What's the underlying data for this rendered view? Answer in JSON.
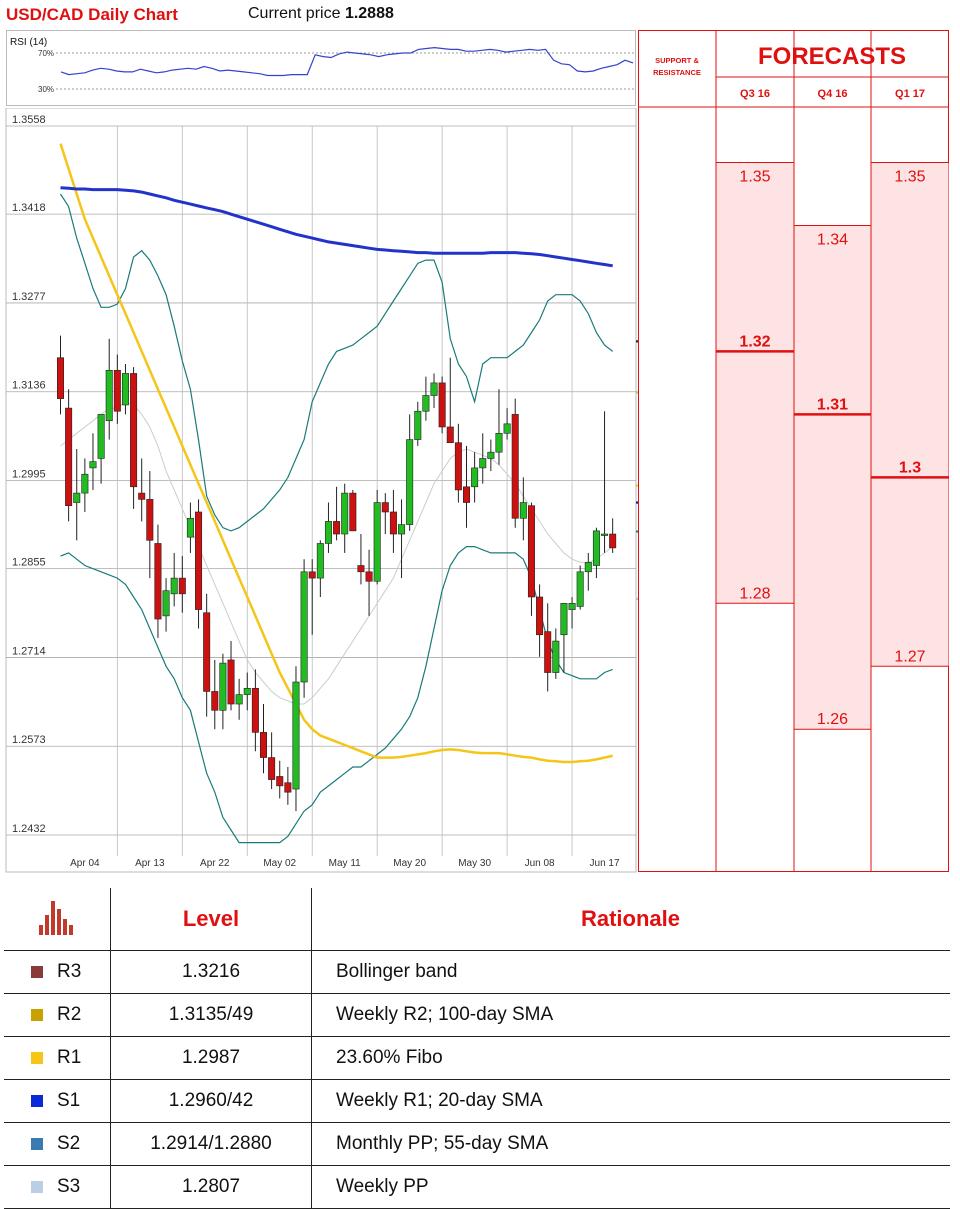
{
  "header": {
    "title": "USD/CAD Daily Chart",
    "price_label": "Current price",
    "price_value": "1.2888"
  },
  "rsi": {
    "label": "RSI (14)",
    "levels": [
      "70%",
      "30%"
    ],
    "values": [
      49,
      46,
      47,
      48,
      51,
      53,
      52,
      50,
      49,
      49,
      52,
      50,
      48,
      49,
      51,
      52,
      53,
      52,
      55,
      53,
      50,
      51,
      50,
      49,
      48,
      47,
      45,
      45,
      45,
      46,
      46,
      46,
      68,
      66,
      65,
      69,
      71,
      70,
      69,
      68,
      66,
      68,
      69,
      70,
      70,
      74,
      75,
      76,
      75,
      74,
      74,
      72,
      72,
      73,
      74,
      73,
      71,
      72,
      73,
      74,
      73,
      74,
      62,
      58,
      57,
      50,
      49,
      50,
      53,
      55,
      57,
      62,
      59
    ]
  },
  "chart_data": {
    "type": "candlestick",
    "title": "USD/CAD Daily Chart",
    "y_ticks": [
      "1.3558",
      "1.3418",
      "1.3277",
      "1.3136",
      "1.2995",
      "1.2855",
      "1.2714",
      "1.2573",
      "1.2432"
    ],
    "ylim": [
      1.2432,
      1.3558
    ],
    "x_ticks": [
      {
        "label": "Apr 04",
        "i": 3
      },
      {
        "label": "Apr 13",
        "i": 11
      },
      {
        "label": "Apr 22",
        "i": 19
      },
      {
        "label": "May 02",
        "i": 27
      },
      {
        "label": "May 11",
        "i": 35
      },
      {
        "label": "May 20",
        "i": 43
      },
      {
        "label": "May 30",
        "i": 51
      },
      {
        "label": "Jun 08",
        "i": 59
      },
      {
        "label": "Jun 17",
        "i": 67
      }
    ],
    "ohlc": [
      [
        1.319,
        1.3225,
        1.31,
        1.3125
      ],
      [
        1.311,
        1.314,
        1.293,
        1.2955
      ],
      [
        1.296,
        1.3045,
        1.29,
        1.2975
      ],
      [
        1.2975,
        1.303,
        1.2945,
        1.3005
      ],
      [
        1.3015,
        1.307,
        1.298,
        1.3025
      ],
      [
        1.303,
        1.309,
        1.299,
        1.31
      ],
      [
        1.309,
        1.322,
        1.306,
        1.317
      ],
      [
        1.317,
        1.3195,
        1.3085,
        1.3105
      ],
      [
        1.3115,
        1.318,
        1.31,
        1.3165
      ],
      [
        1.3165,
        1.3175,
        1.295,
        1.2985
      ],
      [
        1.2975,
        1.303,
        1.293,
        1.2965
      ],
      [
        1.2965,
        1.301,
        1.284,
        1.29
      ],
      [
        1.2895,
        1.2925,
        1.2745,
        1.2775
      ],
      [
        1.278,
        1.284,
        1.2755,
        1.282
      ],
      [
        1.2815,
        1.288,
        1.2795,
        1.284
      ],
      [
        1.284,
        1.2875,
        1.2785,
        1.2815
      ],
      [
        1.2905,
        1.296,
        1.288,
        1.2935
      ],
      [
        1.2945,
        1.2965,
        1.276,
        1.279
      ],
      [
        1.2785,
        1.2815,
        1.262,
        1.266
      ],
      [
        1.266,
        1.271,
        1.26,
        1.263
      ],
      [
        1.263,
        1.272,
        1.26,
        1.2705
      ],
      [
        1.271,
        1.274,
        1.263,
        1.264
      ],
      [
        1.264,
        1.268,
        1.2615,
        1.2655
      ],
      [
        1.2655,
        1.269,
        1.263,
        1.2665
      ],
      [
        1.2665,
        1.2695,
        1.2565,
        1.2595
      ],
      [
        1.2595,
        1.264,
        1.253,
        1.2555
      ],
      [
        1.2555,
        1.2595,
        1.2505,
        1.252
      ],
      [
        1.2525,
        1.255,
        1.249,
        1.251
      ],
      [
        1.2515,
        1.254,
        1.248,
        1.25
      ],
      [
        1.2505,
        1.27,
        1.247,
        1.2675
      ],
      [
        1.2675,
        1.287,
        1.265,
        1.285
      ],
      [
        1.285,
        1.287,
        1.275,
        1.284
      ],
      [
        1.284,
        1.29,
        1.281,
        1.2895
      ],
      [
        1.2895,
        1.296,
        1.288,
        1.293
      ],
      [
        1.293,
        1.2985,
        1.29,
        1.291
      ],
      [
        1.291,
        1.299,
        1.288,
        1.2975
      ],
      [
        1.2975,
        1.298,
        1.292,
        1.2915
      ],
      [
        1.286,
        1.291,
        1.283,
        1.285
      ],
      [
        1.285,
        1.2885,
        1.278,
        1.2835
      ],
      [
        1.2835,
        1.298,
        1.283,
        1.296
      ],
      [
        1.296,
        1.2975,
        1.291,
        1.2945
      ],
      [
        1.2945,
        1.298,
        1.288,
        1.291
      ],
      [
        1.291,
        1.2965,
        1.284,
        1.2925
      ],
      [
        1.2925,
        1.31,
        1.2915,
        1.306
      ],
      [
        1.306,
        1.312,
        1.305,
        1.3105
      ],
      [
        1.3105,
        1.316,
        1.309,
        1.313
      ],
      [
        1.313,
        1.3165,
        1.311,
        1.315
      ],
      [
        1.315,
        1.316,
        1.307,
        1.308
      ],
      [
        1.308,
        1.319,
        1.306,
        1.3055
      ],
      [
        1.3055,
        1.3085,
        1.296,
        1.298
      ],
      [
        1.2985,
        1.305,
        1.292,
        1.296
      ],
      [
        1.2985,
        1.304,
        1.296,
        1.3015
      ],
      [
        1.3015,
        1.307,
        1.299,
        1.303
      ],
      [
        1.303,
        1.306,
        1.301,
        1.304
      ],
      [
        1.304,
        1.314,
        1.302,
        1.307
      ],
      [
        1.307,
        1.311,
        1.306,
        1.3085
      ],
      [
        1.31,
        1.3125,
        1.292,
        1.2935
      ],
      [
        1.2935,
        1.3,
        1.29,
        1.296
      ],
      [
        1.2955,
        1.296,
        1.278,
        1.281
      ],
      [
        1.281,
        1.283,
        1.2715,
        1.275
      ],
      [
        1.2755,
        1.28,
        1.266,
        1.269
      ],
      [
        1.269,
        1.276,
        1.268,
        1.274
      ],
      [
        1.275,
        1.28,
        1.269,
        1.28
      ],
      [
        1.279,
        1.281,
        1.276,
        1.28
      ],
      [
        1.2795,
        1.286,
        1.279,
        1.285
      ],
      [
        1.285,
        1.288,
        1.282,
        1.2865
      ],
      [
        1.286,
        1.292,
        1.284,
        1.2915
      ],
      [
        1.291,
        1.3105,
        1.288,
        1.291
      ],
      [
        1.291,
        1.2935,
        1.288,
        1.2888
      ]
    ],
    "series": [
      {
        "name": "upper-band",
        "color": "#1a7a7a",
        "values": [
          1.345,
          1.343,
          1.338,
          1.334,
          1.33,
          1.327,
          1.327,
          1.3275,
          1.33,
          1.335,
          1.336,
          1.3345,
          1.332,
          1.329,
          1.324,
          1.3185,
          1.314,
          1.306,
          1.297,
          1.294,
          1.292,
          1.2915,
          1.292,
          1.293,
          1.294,
          1.295,
          1.2965,
          1.298,
          1.3,
          1.303,
          1.306,
          1.312,
          1.315,
          1.318,
          1.32,
          1.3205,
          1.321,
          1.322,
          1.323,
          1.324,
          1.326,
          1.328,
          1.33,
          1.332,
          1.334,
          1.3345,
          1.3345,
          1.331,
          1.322,
          1.318,
          1.316,
          1.312,
          1.318,
          1.319,
          1.319,
          1.319,
          1.32,
          1.321,
          1.323,
          1.325,
          1.328,
          1.329,
          1.329,
          1.329,
          1.328,
          1.326,
          1.323,
          1.321,
          1.32
        ]
      },
      {
        "name": "middle-band",
        "color": "#cccccc",
        "values": [
          1.305,
          1.306,
          1.307,
          1.308,
          1.309,
          1.31,
          1.311,
          1.311,
          1.312,
          1.3115,
          1.31,
          1.308,
          1.305,
          1.301,
          1.298,
          1.295,
          1.292,
          1.289,
          1.286,
          1.283,
          1.28,
          1.277,
          1.274,
          1.271,
          1.269,
          1.2675,
          1.266,
          1.265,
          1.2645,
          1.264,
          1.264,
          1.265,
          1.2665,
          1.268,
          1.27,
          1.272,
          1.274,
          1.276,
          1.278,
          1.28,
          1.282,
          1.284,
          1.287,
          1.29,
          1.293,
          1.296,
          1.299,
          1.301,
          1.303,
          1.304,
          1.3045,
          1.304,
          1.3035,
          1.303,
          1.302,
          1.3005,
          1.299,
          1.297,
          1.295,
          1.293,
          1.291,
          1.2895,
          1.288,
          1.287,
          1.2865,
          1.2865,
          1.287,
          1.288,
          1.289
        ]
      },
      {
        "name": "lower-band",
        "color": "#1a7a7a",
        "values": [
          1.2875,
          1.288,
          1.287,
          1.286,
          1.2855,
          1.285,
          1.2845,
          1.284,
          1.283,
          1.281,
          1.279,
          1.276,
          1.273,
          1.27,
          1.268,
          1.265,
          1.263,
          1.258,
          1.253,
          1.25,
          1.246,
          1.244,
          1.242,
          1.242,
          1.242,
          1.242,
          1.242,
          1.242,
          1.243,
          1.245,
          1.247,
          1.248,
          1.25,
          1.251,
          1.252,
          1.253,
          1.254,
          1.254,
          1.255,
          1.256,
          1.257,
          1.2585,
          1.26,
          1.262,
          1.265,
          1.27,
          1.276,
          1.282,
          1.286,
          1.288,
          1.289,
          1.289,
          1.2885,
          1.288,
          1.288,
          1.288,
          1.288,
          1.287,
          1.284,
          1.279,
          1.274,
          1.271,
          1.269,
          1.2685,
          1.268,
          1.268,
          1.268,
          1.269,
          1.2695
        ]
      },
      {
        "name": "sma-yellow",
        "color": "#f5c518",
        "values": [
          1.353,
          1.349,
          1.345,
          1.341,
          1.338,
          1.335,
          1.332,
          1.329,
          1.326,
          1.323,
          1.32,
          1.317,
          1.314,
          1.311,
          1.308,
          1.305,
          1.302,
          1.299,
          1.296,
          1.293,
          1.29,
          1.287,
          1.284,
          1.281,
          1.278,
          1.275,
          1.272,
          1.269,
          1.2665,
          1.264,
          1.2615,
          1.26,
          1.259,
          1.2585,
          1.258,
          1.2575,
          1.257,
          1.2565,
          1.256,
          1.2555,
          1.2555,
          1.2555,
          1.2556,
          1.2558,
          1.256,
          1.2562,
          1.2565,
          1.2567,
          1.2568,
          1.2567,
          1.2565,
          1.2563,
          1.2562,
          1.2562,
          1.2562,
          1.256,
          1.2558,
          1.2556,
          1.2555,
          1.2552,
          1.255,
          1.2549,
          1.2548,
          1.2548,
          1.2549,
          1.255,
          1.2552,
          1.2555,
          1.2558
        ]
      },
      {
        "name": "sma-blue",
        "color": "#2233cc",
        "values": [
          1.346,
          1.3459,
          1.3458,
          1.3458,
          1.3457,
          1.3457,
          1.3457,
          1.3457,
          1.3456,
          1.3455,
          1.3453,
          1.345,
          1.3447,
          1.3444,
          1.344,
          1.3437,
          1.3434,
          1.3431,
          1.3428,
          1.3425,
          1.3422,
          1.3418,
          1.3414,
          1.341,
          1.3406,
          1.3402,
          1.3398,
          1.3394,
          1.339,
          1.3386,
          1.3383,
          1.338,
          1.3377,
          1.3374,
          1.3372,
          1.337,
          1.3368,
          1.3366,
          1.3364,
          1.3362,
          1.3361,
          1.336,
          1.3359,
          1.3358,
          1.3357,
          1.3357,
          1.3356,
          1.3356,
          1.3356,
          1.3356,
          1.3356,
          1.3356,
          1.3356,
          1.3357,
          1.3357,
          1.3357,
          1.3357,
          1.3356,
          1.3355,
          1.3354,
          1.3352,
          1.335,
          1.3348,
          1.3346,
          1.3344,
          1.3342,
          1.334,
          1.3338,
          1.3336
        ]
      }
    ]
  },
  "sr_levels": [
    {
      "label": "1.3216",
      "color": "#5a1030",
      "value": 1.3216
    },
    {
      "label": "1.3135",
      "color": "#d6b36a",
      "value": 1.3135
    },
    {
      "label": "1.2987",
      "color": "#f5c518",
      "value": 1.2987
    },
    {
      "label": "1.2960",
      "color": "#0a0ab0",
      "value": 1.296
    },
    {
      "label": "1.2914",
      "color": "#3a7aa0",
      "value": 1.2914
    },
    {
      "label": "1.2807",
      "color": "#a9ccd6",
      "value": 1.2807
    }
  ],
  "forecasts": {
    "title": "FORECASTS",
    "sr_header": [
      "SUPPORT &",
      "RESISTANCE"
    ],
    "columns": [
      {
        "label": "Q3 16",
        "high": "1.35",
        "mid": "1.32",
        "low": "1.28",
        "high_v": 1.35,
        "mid_v": 1.32,
        "low_v": 1.28
      },
      {
        "label": "Q4 16",
        "high": "1.34",
        "mid": "1.31",
        "low": "1.26",
        "high_v": 1.34,
        "mid_v": 1.31,
        "low_v": 1.26
      },
      {
        "label": "Q1 17",
        "high": "1.35",
        "mid": "1.3",
        "low": "1.27",
        "high_v": 1.35,
        "mid_v": 1.3,
        "low_v": 1.27
      }
    ]
  },
  "table": {
    "headers": {
      "level": "Level",
      "rationale": "Rationale"
    },
    "rows": [
      {
        "name": "R3",
        "level": "1.3216",
        "rationale": "Bollinger band",
        "color": "#8b3a3a"
      },
      {
        "name": "R2",
        "level": "1.3135/49",
        "rationale": "Weekly R2; 100-day SMA",
        "color": "#c8a000"
      },
      {
        "name": "R1",
        "level": "1.2987",
        "rationale": "23.60% Fibo",
        "color": "#f5c518"
      },
      {
        "name": "S1",
        "level": "1.2960/42",
        "rationale": "Weekly R1; 20-day SMA",
        "color": "#0a2ad8"
      },
      {
        "name": "S2",
        "level": "1.2914/1.2880",
        "rationale": "Monthly PP; 55-day SMA",
        "color": "#3a7ab0"
      },
      {
        "name": "S3",
        "level": "1.2807",
        "rationale": "Weekly PP",
        "color": "#b8cfe6"
      }
    ]
  },
  "colors": {
    "accent": "#e01010",
    "bull": "#22bb22",
    "bear": "#cc1111",
    "forecast_fill": "#fde3e3"
  }
}
